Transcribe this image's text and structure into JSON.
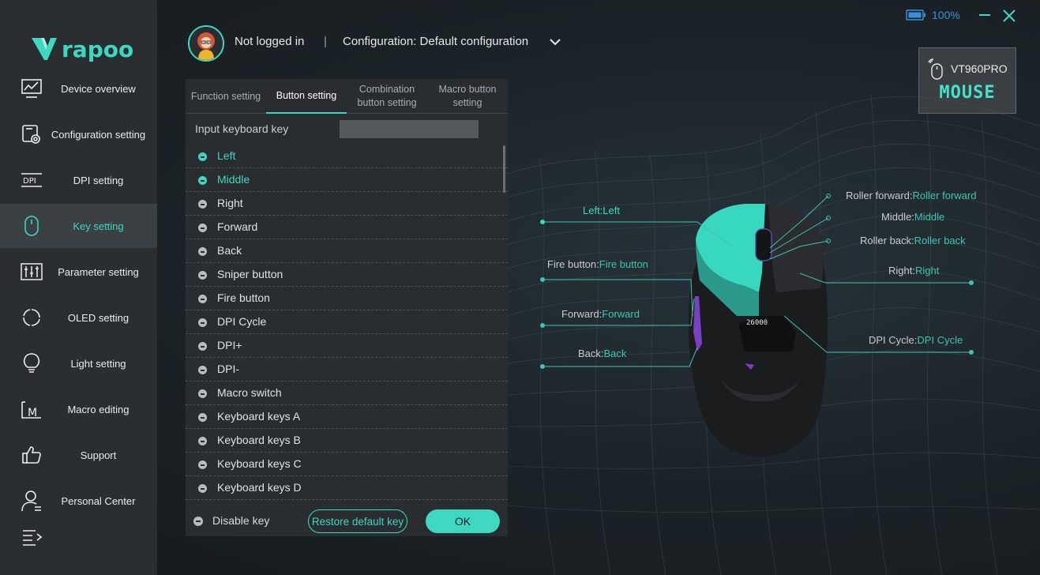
{
  "sidebar": {
    "logo_text": "rapoo",
    "items": [
      {
        "label": "Device overview",
        "icon": "monitor-chart-icon"
      },
      {
        "label": "Configuration setting",
        "icon": "config-gear-icon"
      },
      {
        "label": "DPI setting",
        "icon": "dpi-icon",
        "icon_text": "DPI"
      },
      {
        "label": "Key setting",
        "icon": "mouse-icon",
        "active": true
      },
      {
        "label": "Parameter setting",
        "icon": "sliders-icon"
      },
      {
        "label": "OLED setting",
        "icon": "refresh-circle-icon"
      },
      {
        "label": "Light setting",
        "icon": "lightbulb-icon"
      },
      {
        "label": "Macro editing",
        "icon": "macro-icon",
        "icon_text": "M"
      },
      {
        "label": "Support",
        "icon": "thumbs-up-icon"
      },
      {
        "label": "Personal Center",
        "icon": "user-icon"
      }
    ]
  },
  "header": {
    "login_status": "Not logged in",
    "separator": "|",
    "configuration": "Configuration: Default configuration"
  },
  "window": {
    "battery": "100%",
    "battery_color": "#3a8fd8"
  },
  "device": {
    "name": "VT960PRO",
    "type": "MOUSE"
  },
  "panel": {
    "tabs": [
      {
        "label": "Function setting"
      },
      {
        "label": "Button setting",
        "active": true
      },
      {
        "label": "Combination button setting"
      },
      {
        "label": "Macro button setting"
      }
    ],
    "input_label": "Input keyboard key",
    "input_value": "",
    "keys": [
      {
        "label": "Left",
        "selected": true
      },
      {
        "label": "Middle",
        "highlight": true
      },
      {
        "label": "Right"
      },
      {
        "label": "Forward"
      },
      {
        "label": "Back"
      },
      {
        "label": "Sniper button"
      },
      {
        "label": "Fire button"
      },
      {
        "label": "DPI Cycle"
      },
      {
        "label": "DPI+"
      },
      {
        "label": "DPI-"
      },
      {
        "label": "Macro switch"
      },
      {
        "label": "Keyboard keys A"
      },
      {
        "label": "Keyboard keys B"
      },
      {
        "label": "Keyboard keys C"
      },
      {
        "label": "Keyboard keys D"
      }
    ],
    "disable_label": "Disable key",
    "restore_label": "Restore default key",
    "ok_label": "OK"
  },
  "mouse_map": {
    "left": {
      "key": "Left:",
      "value": "Left"
    },
    "fire": {
      "key": "Fire button:",
      "value": "Fire button"
    },
    "forward": {
      "key": "Forward:",
      "value": "Forward"
    },
    "back": {
      "key": "Back:",
      "value": "Back"
    },
    "roller_forward": {
      "key": "Roller forward:",
      "value": "Roller forward"
    },
    "middle": {
      "key": "Middle:",
      "value": "Middle"
    },
    "roller_back": {
      "key": "Roller back:",
      "value": "Roller back"
    },
    "right": {
      "key": "Right:",
      "value": "Right"
    },
    "dpi_cycle": {
      "key": "DPI Cycle:",
      "value": "DPI Cycle"
    },
    "oled_text": "26000"
  },
  "colors": {
    "accent": "#3ed7c0",
    "sidebar_bg": "#2b2e31",
    "panel_bg": "#2a2d30",
    "purple": "#7b3fc4"
  }
}
